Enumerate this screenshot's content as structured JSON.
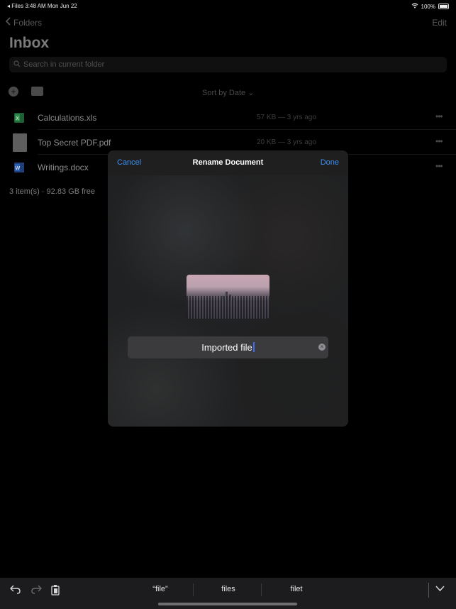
{
  "status_bar": {
    "left": "◂ Files  3:48 AM   Mon Jun 22",
    "battery": "100%"
  },
  "nav": {
    "back_label": "Folders",
    "edit_label": "Edit",
    "title": "Inbox"
  },
  "search": {
    "placeholder": "Search in current folder"
  },
  "toolbar": {
    "sort_label": "Sort by Date"
  },
  "files": [
    {
      "name": "Calculations.xls",
      "meta": "57 KB — 3 yrs ago",
      "icon": "excel-icon"
    },
    {
      "name": "Top Secret PDF.pdf",
      "meta": "20 KB — 3 yrs ago",
      "icon": "pdf-icon"
    },
    {
      "name": "Writings.docx",
      "meta": "",
      "icon": "word-icon"
    }
  ],
  "folder_info": "3 item(s) · 92.83 GB free",
  "modal": {
    "cancel_label": "Cancel",
    "title": "Rename Document",
    "done_label": "Done",
    "filename_value": "Imported file"
  },
  "keyboard": {
    "suggestions": [
      "“file”",
      "files",
      "filet"
    ]
  },
  "colors": {
    "accent": "#3d8ef0",
    "caret": "#3d6df2"
  }
}
